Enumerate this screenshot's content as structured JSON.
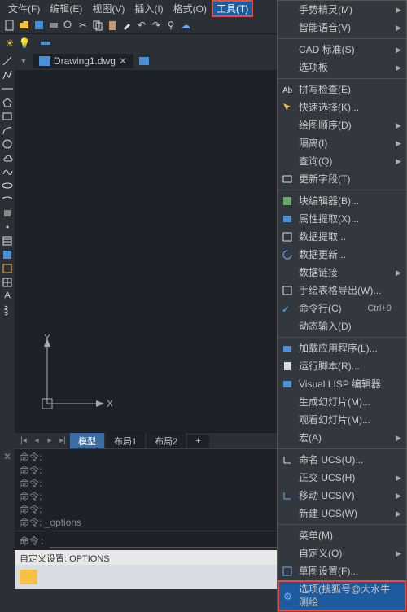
{
  "menubar": {
    "file": "文件(F)",
    "edit": "编辑(E)",
    "view": "视图(V)",
    "insert": "插入(I)",
    "format": "格式(O)",
    "tools": "工具(T)"
  },
  "doc": {
    "name": "Drawing1.dwg"
  },
  "ucs": {
    "x": "X",
    "y": "Y"
  },
  "layout_tabs": {
    "model": "模型",
    "layout1": "布局1",
    "layout2": "布局2",
    "plus": "+"
  },
  "cmd": {
    "p1": "命令:",
    "p2": "命令:",
    "p3": "命令:",
    "p4": "命令:",
    "p5": "命令:",
    "p6": "命令: _options",
    "prompt": "命令:"
  },
  "status": {
    "text": "自定义设置: OPTIONS"
  },
  "dropdown": {
    "gesture": "手势精灵(M)",
    "voice": "智能语音(V)",
    "cadstd": "CAD 标准(S)",
    "palette": "选项板",
    "spell": "拼写检查(E)",
    "quicksel": "快速选择(K)...",
    "draworder": "绘图顺序(D)",
    "isolate": "隔离(I)",
    "inquiry": "查询(Q)",
    "updatefield": "更新字段(T)",
    "blockedit": "块编辑器(B)...",
    "attrext": "属性提取(X)...",
    "dataext": "数据提取...",
    "dataupd": "数据更新...",
    "datalink": "数据链接",
    "tblexport": "手绘表格导出(W)...",
    "cmdline": "命令行(C)",
    "cmdline_shortcut": "Ctrl+9",
    "dyninput": "动态输入(D)",
    "loadapp": "加载应用程序(L)...",
    "runscript": "运行脚本(R)...",
    "vlisp": "Visual LISP 编辑器",
    "makeslide": "生成幻灯片(M)...",
    "viewslide": "观看幻灯片(M)...",
    "macro": "宏(A)",
    "namedocs": "命名 UCS(U)...",
    "orthoucs": "正交 UCS(H)",
    "moveucs": "移动 UCS(V)",
    "newucs": "新建 UCS(W)",
    "menu": "菜单(M)",
    "custom": "自定义(O)",
    "drafting": "草图设置(F)...",
    "options": "选项(搜狐号@大水牛测绘"
  }
}
